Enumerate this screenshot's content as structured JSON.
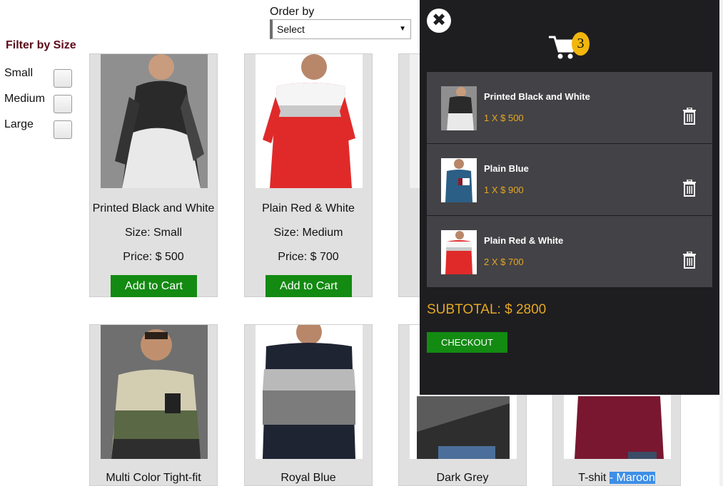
{
  "order": {
    "label": "Order by",
    "selected": "Select"
  },
  "filter": {
    "title": "Filter by Size",
    "options": [
      "Small",
      "Medium",
      "Large"
    ]
  },
  "products": [
    {
      "name": "Printed Black and White",
      "size": "Size: Small",
      "price": "Price: $ 500",
      "button": "Add to Cart"
    },
    {
      "name": "Plain Red & White",
      "size": "Size: Medium",
      "price": "Price: $ 700",
      "button": "Add to Cart"
    },
    {
      "name": "Multi Color Tight-fit"
    },
    {
      "name": "Royal Blue"
    },
    {
      "name": "Dark Grey"
    },
    {
      "name_a": "T-shit ",
      "name_b": "- Maroon"
    }
  ],
  "cart": {
    "count": "3",
    "items": [
      {
        "name": "Printed Black and White",
        "qty": "1 X $ 500"
      },
      {
        "name": "Plain Blue",
        "qty": "1 X $ 900"
      },
      {
        "name": "Plain Red & White",
        "qty": "2 X $ 700"
      }
    ],
    "subtotal": "SUBTOTAL: $ 2800",
    "checkout": "CHECKOUT"
  },
  "icons": {
    "close": "close-icon",
    "cart": "cart-icon",
    "trash": "trash-icon",
    "caret": "caret-down-icon"
  },
  "colors": {
    "accent_green": "#138a12",
    "accent_gold": "#e5a823",
    "panel_bg": "#1e1e21",
    "filter_title": "#5c0a1a"
  }
}
